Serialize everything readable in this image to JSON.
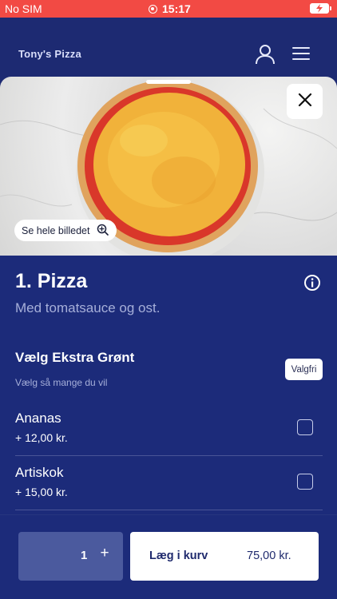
{
  "status_bar": {
    "carrier": "No SIM",
    "time": "15:17"
  },
  "header": {
    "brand": "Tony's Pizza",
    "icons": [
      "user-icon",
      "hamburger-menu-icon"
    ]
  },
  "hero": {
    "view_photo_label": "Se hele billedet",
    "icons": [
      "close-icon",
      "zoom-in-icon"
    ]
  },
  "product": {
    "title": "1. Pizza",
    "description": "Med tomatsauce og ost."
  },
  "extras": {
    "title": "Vælg Ekstra Grønt",
    "subtitle": "Vælg så mange du vil",
    "badge": "Valgfri",
    "options": [
      {
        "name": "Ananas",
        "price": "+ 12,00 kr."
      },
      {
        "name": "Artiskok",
        "price": "+ 15,00 kr."
      }
    ]
  },
  "cart": {
    "quantity": "1",
    "plus": "+",
    "add_label": "Læg i kurv",
    "total": "75,00 kr."
  },
  "colors": {
    "status_bar": "#f24a44",
    "background": "#1c2b7a",
    "stepper": "#4b5a9e"
  }
}
